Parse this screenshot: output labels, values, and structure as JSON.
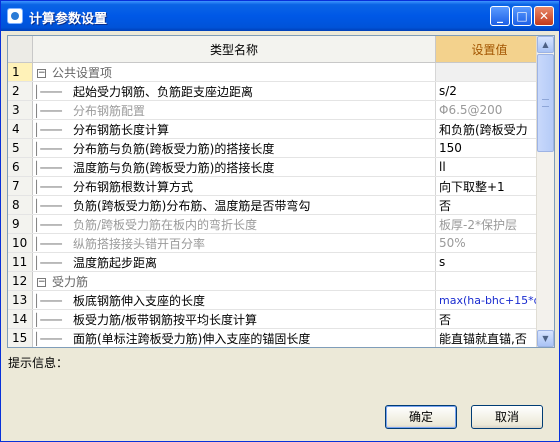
{
  "window": {
    "title": "计算参数设置"
  },
  "table": {
    "columns": {
      "name": "类型名称",
      "value": "设置值"
    },
    "rows": [
      {
        "num": "1",
        "name": "公共设置项",
        "value": "",
        "section": true,
        "expander": "−",
        "selected": true
      },
      {
        "num": "2",
        "name": "起始受力钢筋、负筋距支座边距离",
        "value": "s/2"
      },
      {
        "num": "3",
        "name": "分布钢筋配置",
        "value": "Φ6.5@200",
        "gray": true
      },
      {
        "num": "4",
        "name": "分布钢筋长度计算",
        "value": "和负筋(跨板受力"
      },
      {
        "num": "5",
        "name": "分布筋与负筋(跨板受力筋)的搭接长度",
        "value": "150"
      },
      {
        "num": "6",
        "name": "温度筋与负筋(跨板受力筋)的搭接长度",
        "value": "ll"
      },
      {
        "num": "7",
        "name": "分布钢筋根数计算方式",
        "value": "向下取整+1"
      },
      {
        "num": "8",
        "name": "负筋(跨板受力筋)分布筋、温度筋是否带弯勾",
        "value": "否"
      },
      {
        "num": "9",
        "name": "负筋/跨板受力筋在板内的弯折长度",
        "value": "板厚-2*保护层",
        "gray": true
      },
      {
        "num": "10",
        "name": "纵筋搭接接头错开百分率",
        "value": "50%",
        "gray": true
      },
      {
        "num": "11",
        "name": "温度筋起步距离",
        "value": "s"
      },
      {
        "num": "12",
        "name": "受力筋",
        "value": "",
        "section": true,
        "expander": "−"
      },
      {
        "num": "13",
        "name": "板底钢筋伸入支座的长度",
        "value": "max(ha-bhc+15*d,",
        "blue": true
      },
      {
        "num": "14",
        "name": "板受力筋/板带钢筋按平均长度计算",
        "value": "否"
      },
      {
        "num": "15",
        "name": "面筋(单标注跨板受力筋)伸入支座的锚固长度",
        "value": "能直锚就直锚,否"
      }
    ]
  },
  "hint": {
    "label": "提示信息："
  },
  "buttons": {
    "ok": "确定",
    "cancel": "取消"
  },
  "colors": {
    "title_bar": "#0058e6",
    "value_header_bg": "#f3d28d",
    "value_header_text": "#a25500"
  },
  "icons": {
    "app": "app-icon",
    "minimize": "minimize-icon",
    "maximize": "maximize-icon",
    "close": "close-icon",
    "expander": "collapse-icon"
  }
}
